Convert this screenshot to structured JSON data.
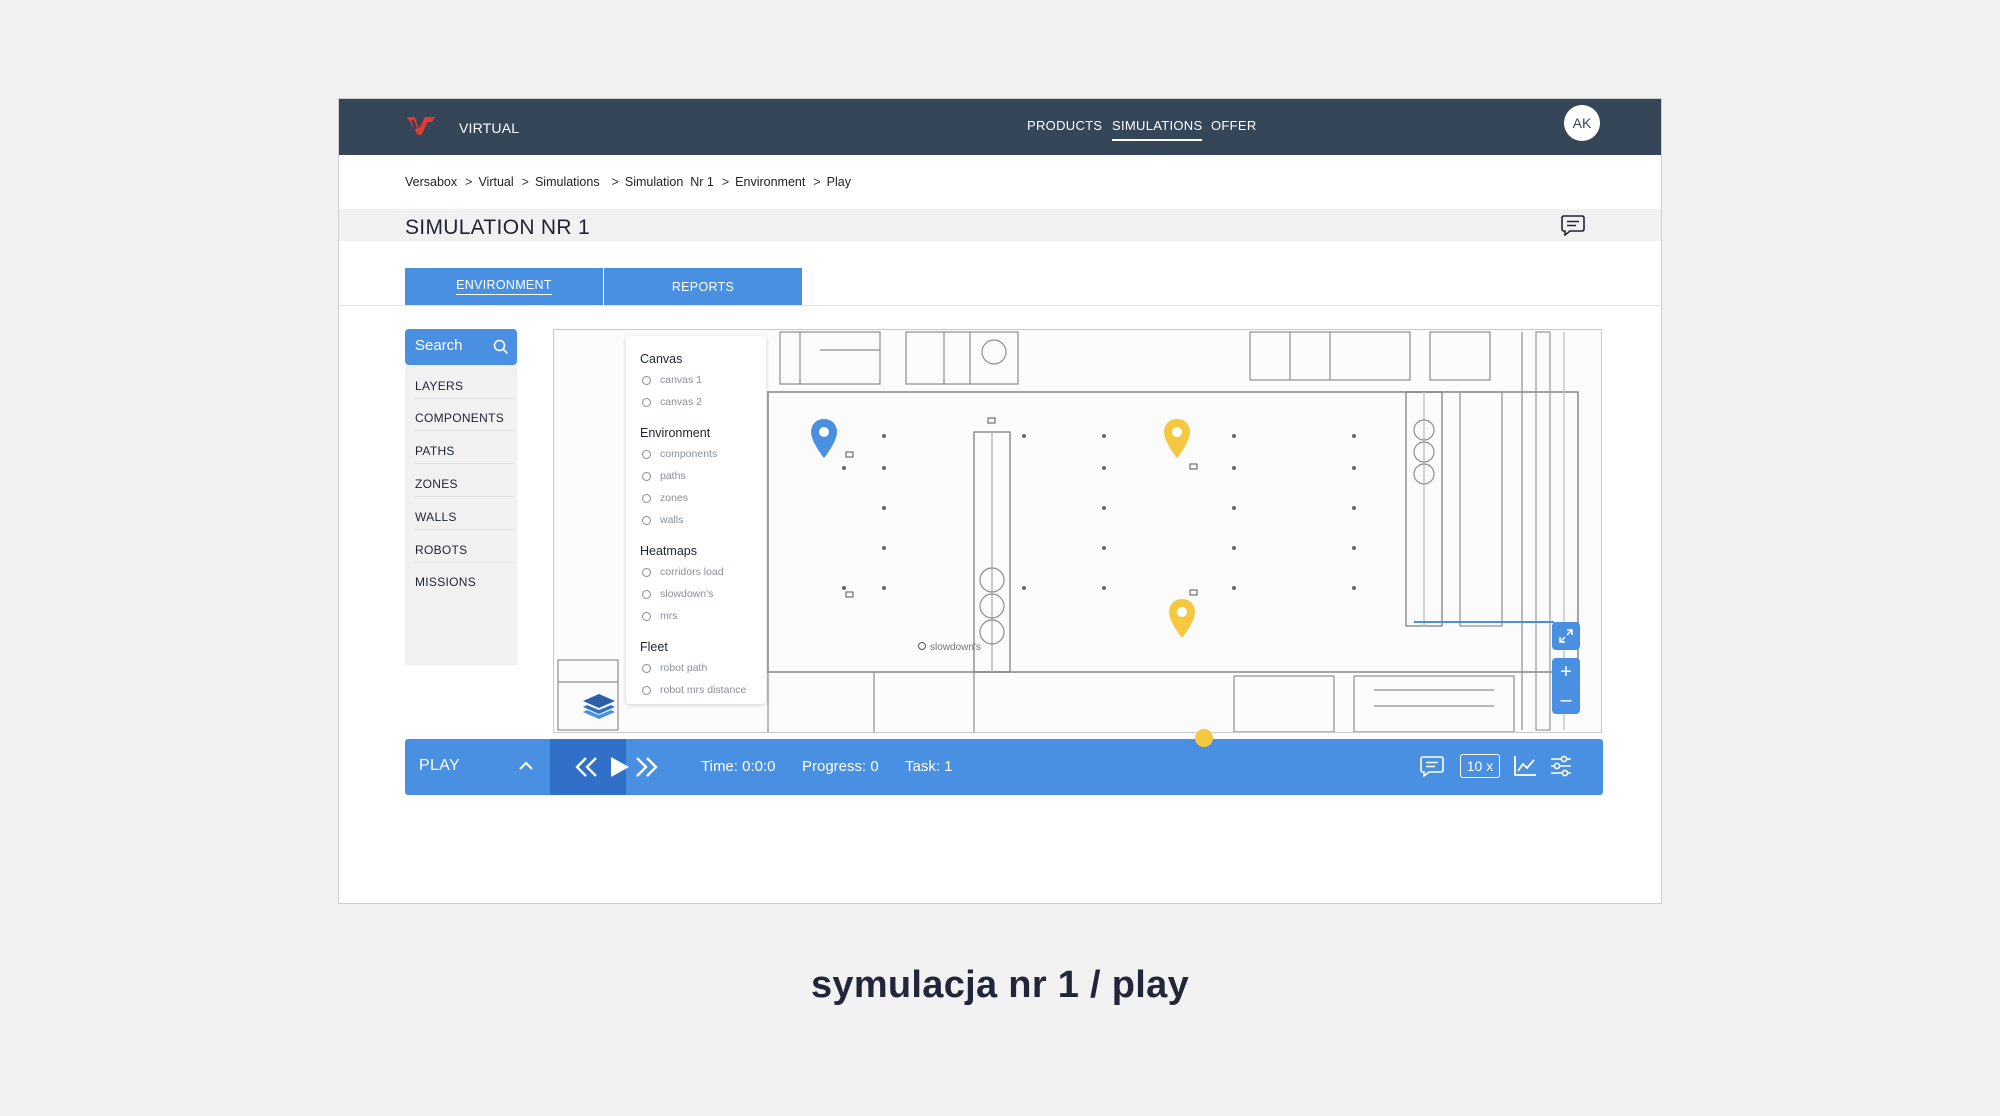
{
  "header": {
    "brand": "VIRTUAL",
    "nav": [
      "PRODUCTS",
      "SIMULATIONS",
      "OFFER"
    ],
    "active_nav": "SIMULATIONS",
    "avatar_initials": "AK"
  },
  "breadcrumb": [
    "Versabox",
    "Virtual",
    "Simulations",
    "Simulation  Nr 1",
    "Environment",
    "Play"
  ],
  "page": {
    "title": "SIMULATION NR 1"
  },
  "tabs": [
    {
      "label": "ENVIRONMENT",
      "active": true
    },
    {
      "label": "REPORTS",
      "active": false
    }
  ],
  "sidebar": {
    "search_placeholder": "Search",
    "items": [
      "LAYERS",
      "COMPONENTS",
      "PATHS",
      "ZONES",
      "WALLS",
      "ROBOTS",
      "MISSIONS"
    ]
  },
  "layers_panel": {
    "groups": [
      {
        "title": "Canvas",
        "options": [
          "canvas 1",
          "canvas 2"
        ]
      },
      {
        "title": "Environment",
        "options": [
          "components",
          "paths",
          "zones",
          "walls"
        ]
      },
      {
        "title": "Heatmaps",
        "options": [
          "corridors load",
          "slowdown's",
          "mrs"
        ]
      },
      {
        "title": "Fleet",
        "options": [
          "robot path",
          "robot mrs distance"
        ]
      }
    ]
  },
  "map": {
    "annotation": "slowdown's",
    "markers": [
      {
        "icon": "map-pin-icon",
        "color": "#4a90e2"
      },
      {
        "icon": "map-pin-icon",
        "color": "#f5c842"
      },
      {
        "icon": "map-pin-icon",
        "color": "#f5c842"
      }
    ]
  },
  "playbar": {
    "label": "PLAY",
    "time": "Time: 0:0:0",
    "progress": "Progress: 0",
    "task": "Task: 1",
    "speed": "10 x"
  },
  "caption": "symulacja nr 1 / play",
  "colors": {
    "nav_bg": "#344658",
    "accent": "#4a90e2",
    "accent_dark": "#3070c8",
    "marker_yellow": "#f5c842"
  }
}
